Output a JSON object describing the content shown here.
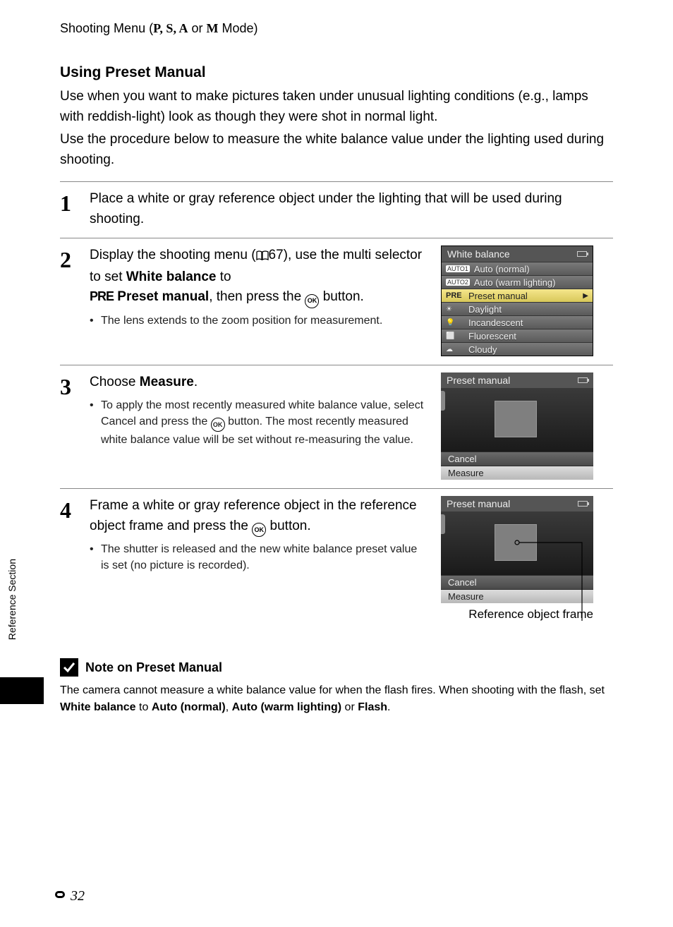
{
  "breadcrumb": {
    "prefix": "Shooting Menu (",
    "modes": "P, S, A",
    "or": " or ",
    "mmode": "M",
    "suffix": " Mode)"
  },
  "heading": "Using Preset Manual",
  "intro1": "Use when you want to make pictures taken under unusual lighting conditions (e.g., lamps with reddish-light) look as though they were shot in normal light.",
  "intro2": "Use the procedure below to measure the white balance value under the lighting used during shooting.",
  "steps": {
    "s1": {
      "num": "1",
      "text": "Place a white or gray reference object under the lighting that will be used during shooting."
    },
    "s2": {
      "num": "2",
      "text_a": "Display the shooting menu (",
      "page_ref": "67",
      "text_b": "), use the multi selector to set ",
      "bold1": "White balance",
      "text_c": " to ",
      "pre": "PRE",
      "bold2": " Preset manual",
      "text_d": ", then press the ",
      "ok": "OK",
      "text_e": " button.",
      "bullet": "The lens extends to the zoom position for measurement."
    },
    "s3": {
      "num": "3",
      "text_a": "Choose ",
      "bold1": "Measure",
      "text_b": ".",
      "bullet_a": "To apply the most recently measured white balance value, select ",
      "bullet_bold": "Cancel",
      "bullet_b": " and press the ",
      "ok": "OK",
      "bullet_c": " button. The most recently measured white balance value will be set without re-measuring the value."
    },
    "s4": {
      "num": "4",
      "text_a": "Frame a white or gray reference object in the reference object frame and press the ",
      "ok": "OK",
      "text_b": " button.",
      "bullet": "The shutter is released and the new white balance preset value is set (no picture is recorded).",
      "callout": "Reference object frame"
    }
  },
  "lcd1": {
    "title": "White balance",
    "items": [
      {
        "ico": "AUTO1",
        "lbl": "Auto (normal)"
      },
      {
        "ico": "AUTO2",
        "lbl": "Auto (warm lighting)"
      },
      {
        "ico": "PRE",
        "lbl": "Preset manual",
        "sel": true
      },
      {
        "ico": "☀",
        "lbl": "Daylight"
      },
      {
        "ico": "💡",
        "lbl": "Incandescent"
      },
      {
        "ico": "⬜",
        "lbl": "Fluorescent"
      },
      {
        "ico": "☁",
        "lbl": "Cloudy"
      }
    ]
  },
  "lcd2": {
    "title": "Preset manual",
    "cancel": "Cancel",
    "measure": "Measure"
  },
  "lcd3": {
    "title": "Preset manual",
    "cancel": "Cancel",
    "measure": "Measure"
  },
  "note": {
    "title": "Note on Preset Manual",
    "a": "The camera cannot measure a white balance value for when the flash fires. When shooting with the flash, set ",
    "b1": "White balance",
    "c": " to ",
    "b2": "Auto (normal)",
    "d": ", ",
    "b3": "Auto (warm lighting)",
    "e": " or ",
    "b4": "Flash",
    "f": "."
  },
  "side_tab": "Reference Section",
  "page_number": "32"
}
